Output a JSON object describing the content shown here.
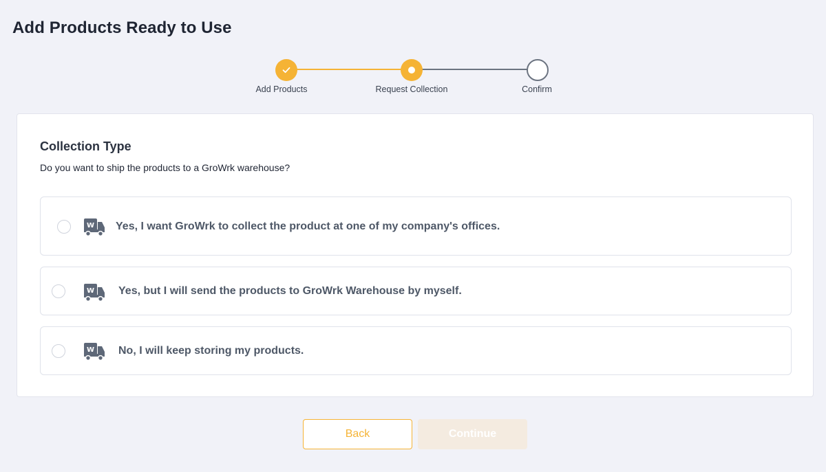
{
  "page": {
    "title": "Add Products Ready to Use"
  },
  "stepper": {
    "steps": [
      {
        "label": "Add Products",
        "state": "completed"
      },
      {
        "label": "Request Collection",
        "state": "active"
      },
      {
        "label": "Confirm",
        "state": "pending"
      }
    ]
  },
  "collection": {
    "title": "Collection Type",
    "question": "Do you want to ship the products to a GroWrk warehouse?",
    "options": [
      {
        "label": "Yes, I want GroWrk to collect the product at one of my company's offices.",
        "icon": "warehouse-truck-icon",
        "selected": false
      },
      {
        "label": "Yes, but I will send the products to GroWrk Warehouse by myself.",
        "icon": "warehouse-truck-icon",
        "selected": false
      },
      {
        "label": "No, I will keep storing my products.",
        "icon": "warehouse-truck-icon",
        "selected": false
      }
    ]
  },
  "actions": {
    "back_label": "Back",
    "continue_label": "Continue",
    "continue_enabled": false
  },
  "colors": {
    "accent": "#f5b335",
    "background": "#f1f2f8",
    "muted_line": "#6b7380",
    "option_text": "#4e5867",
    "continue_disabled_bg": "#f4ebe0"
  }
}
